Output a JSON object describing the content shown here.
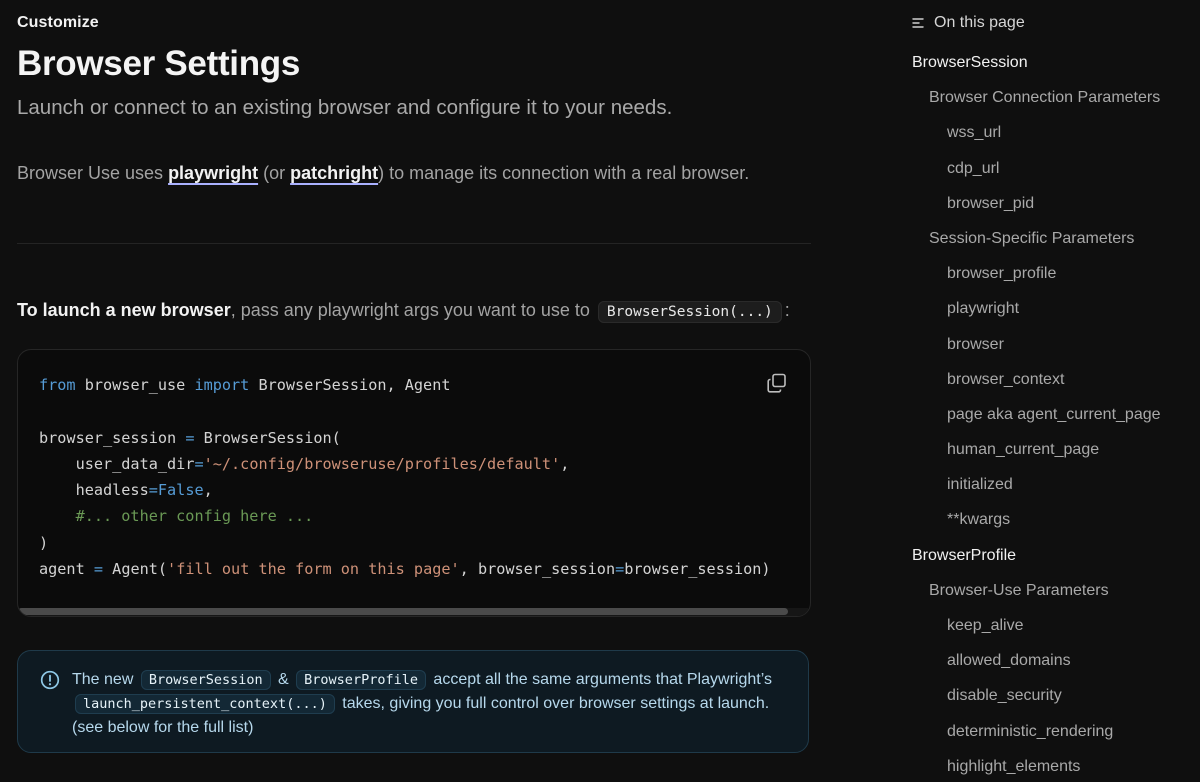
{
  "header": {
    "eyebrow": "Customize",
    "title": "Browser Settings",
    "description": "Launch or connect to an existing browser and configure it to your needs."
  },
  "intro": {
    "prefix": "Browser Use uses ",
    "link1": "playwright",
    "middle": " (or ",
    "link2": "patchright",
    "suffix": ") to manage its connection with a real browser."
  },
  "launch": {
    "bold": "To launch a new browser",
    "text": ", pass any playwright args you want to use to ",
    "code": "BrowserSession(...)",
    "end": ":"
  },
  "code": {
    "l1_from": "from",
    "l1_mod": " browser_use ",
    "l1_import": "import",
    "l1_rest": " BrowserSession, Agent",
    "l3_a": "browser_session ",
    "l3_eq": "=",
    "l3_b": " BrowserSession(",
    "l4_a": "    user_data_dir",
    "l4_eq": "=",
    "l4_str": "'~/.config/browseruse/profiles/default'",
    "l4_end": ",",
    "l5_a": "    headless",
    "l5_eq": "=",
    "l5_val": "False",
    "l5_end": ",",
    "l6_comment": "    #... other config here ...",
    "l7": ")",
    "l8_a": "agent ",
    "l8_eq": "=",
    "l8_b": " Agent(",
    "l8_str": "'fill out the form on this page'",
    "l8_c": ", browser_session",
    "l8_eq2": "=",
    "l8_d": "browser_session)"
  },
  "callout": {
    "t1": "The new ",
    "c1": "BrowserSession",
    "t2": " & ",
    "c2": "BrowserProfile",
    "t3": " accept all the same arguments that Playwright’s ",
    "c3": "launch_persistent_context(...)",
    "t4": " takes, giving you full control over browser settings at launch. (see below for the full list)"
  },
  "toc": {
    "header": "On this page",
    "items": [
      {
        "label": "BrowserSession",
        "level": 0
      },
      {
        "label": "Browser Connection Parameters",
        "level": 1
      },
      {
        "label": "wss_url",
        "level": 2
      },
      {
        "label": "cdp_url",
        "level": 2
      },
      {
        "label": "browser_pid",
        "level": 2
      },
      {
        "label": "Session-Specific Parameters",
        "level": 1
      },
      {
        "label": "browser_profile",
        "level": 2
      },
      {
        "label": "playwright",
        "level": 2
      },
      {
        "label": "browser",
        "level": 2
      },
      {
        "label": "browser_context",
        "level": 2
      },
      {
        "label": "page aka agent_current_page",
        "level": 2
      },
      {
        "label": "human_current_page",
        "level": 2
      },
      {
        "label": "initialized",
        "level": 2
      },
      {
        "label": "**kwargs",
        "level": 2
      },
      {
        "label": "BrowserProfile",
        "level": 0
      },
      {
        "label": "Browser-Use Parameters",
        "level": 1
      },
      {
        "label": "keep_alive",
        "level": 2
      },
      {
        "label": "allowed_domains",
        "level": 2
      },
      {
        "label": "disable_security",
        "level": 2
      },
      {
        "label": "deterministic_rendering",
        "level": 2
      },
      {
        "label": "highlight_elements",
        "level": 2
      }
    ]
  },
  "colors": {
    "background": "#0f0f0f",
    "link_underline": "#aab1ff",
    "keyword": "#569cd6",
    "string": "#ce9178",
    "comment": "#6a9955",
    "callout_bg": "#0e1a22",
    "callout_border": "#1f3a4a"
  },
  "icons": {
    "toc": "list-icon",
    "copy": "copy-icon",
    "callout": "info-icon"
  }
}
